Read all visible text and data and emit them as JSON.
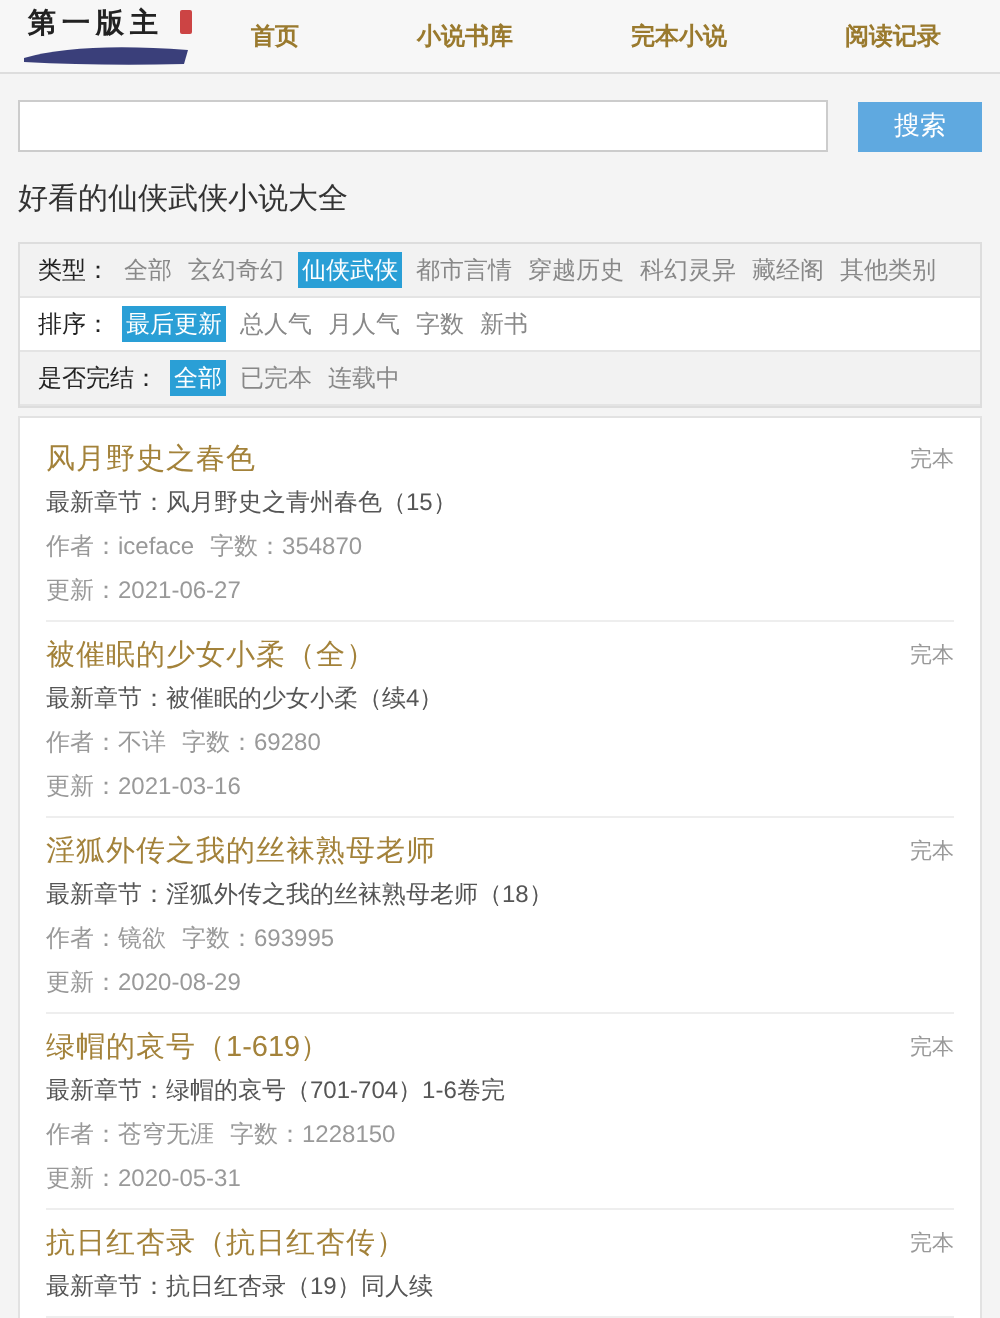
{
  "header": {
    "logo": "第一版主",
    "nav": [
      "首页",
      "小说书库",
      "完本小说",
      "阅读记录"
    ]
  },
  "search": {
    "button": "搜索"
  },
  "page_title": "好看的仙侠武侠小说大全",
  "filters": [
    {
      "label": "类型：",
      "options": [
        {
          "text": "全部",
          "selected": false
        },
        {
          "text": "玄幻奇幻",
          "selected": false
        },
        {
          "text": "仙侠武侠",
          "selected": true
        },
        {
          "text": "都市言情",
          "selected": false
        },
        {
          "text": "穿越历史",
          "selected": false
        },
        {
          "text": "科幻灵异",
          "selected": false
        },
        {
          "text": "藏经阁",
          "selected": false
        },
        {
          "text": "其他类别",
          "selected": false
        }
      ]
    },
    {
      "label": "排序：",
      "options": [
        {
          "text": "最后更新",
          "selected": true
        },
        {
          "text": "总人气",
          "selected": false
        },
        {
          "text": "月人气",
          "selected": false
        },
        {
          "text": "字数",
          "selected": false
        },
        {
          "text": "新书",
          "selected": false
        }
      ]
    },
    {
      "label": "是否完结：",
      "options": [
        {
          "text": "全部",
          "selected": true
        },
        {
          "text": "已完本",
          "selected": false
        },
        {
          "text": "连载中",
          "selected": false
        }
      ]
    }
  ],
  "books": [
    {
      "title": "风月野史之春色",
      "status": "完本",
      "latest": "最新章节：风月野史之青州春色（15）",
      "author": "作者：iceface",
      "words": "字数：354870",
      "updated": "更新：2021-06-27"
    },
    {
      "title": "被催眠的少女小柔（全）",
      "status": "完本",
      "latest": "最新章节：被催眠的少女小柔（续4）",
      "author": "作者：不详",
      "words": "字数：69280",
      "updated": "更新：2021-03-16"
    },
    {
      "title": "淫狐外传之我的丝袜熟母老师",
      "status": "完本",
      "latest": "最新章节：淫狐外传之我的丝袜熟母老师（18）",
      "author": "作者：镜欲",
      "words": "字数：693995",
      "updated": "更新：2020-08-29"
    },
    {
      "title": "绿帽的哀号（1-619）",
      "status": "完本",
      "latest": "最新章节：绿帽的哀号（701-704）1-6卷完",
      "author": "作者：苍穹无涯",
      "words": "字数：1228150",
      "updated": "更新：2020-05-31"
    },
    {
      "title": "抗日红杏录（抗日红杏传）",
      "status": "完本",
      "latest": "最新章节：抗日红杏录（19）同人续"
    }
  ]
}
